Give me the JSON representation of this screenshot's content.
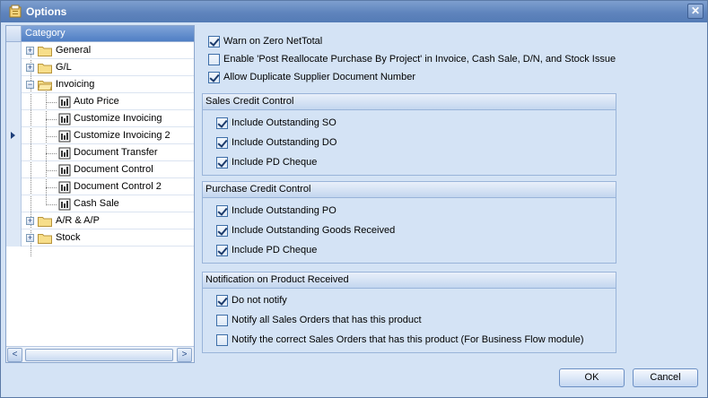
{
  "window": {
    "title": "Options",
    "close_glyph": "✕"
  },
  "tree": {
    "header": "Category",
    "nodes": [
      {
        "label": "General"
      },
      {
        "label": "G/L"
      },
      {
        "label": "Invoicing"
      },
      {
        "label": "Auto Price"
      },
      {
        "label": "Customize Invoicing"
      },
      {
        "label": "Customize Invoicing 2"
      },
      {
        "label": "Document Transfer"
      },
      {
        "label": "Document Control"
      },
      {
        "label": "Document Control 2"
      },
      {
        "label": "Cash Sale"
      },
      {
        "label": "A/R & A/P"
      },
      {
        "label": "Stock"
      }
    ],
    "selected": "Customize Invoicing 2",
    "scroll_left": "<",
    "scroll_right": ">"
  },
  "options": {
    "top": [
      {
        "label": "Warn on Zero NetTotal",
        "checked": true
      },
      {
        "label": "Enable 'Post Reallocate Purchase By Project' in Invoice, Cash Sale, D/N, and Stock Issue",
        "checked": false
      },
      {
        "label": "Allow Duplicate Supplier Document Number",
        "checked": true
      }
    ],
    "sales_credit": {
      "title": "Sales Credit Control",
      "items": [
        {
          "label": "Include Outstanding SO",
          "checked": true
        },
        {
          "label": "Include Outstanding DO",
          "checked": true
        },
        {
          "label": "Include PD Cheque",
          "checked": true
        }
      ]
    },
    "purchase_credit": {
      "title": "Purchase Credit Control",
      "items": [
        {
          "label": "Include Outstanding PO",
          "checked": true
        },
        {
          "label": "Include Outstanding Goods Received",
          "checked": true
        },
        {
          "label": "Include PD Cheque",
          "checked": true
        }
      ]
    },
    "notification": {
      "title": "Notification on Product Received",
      "items": [
        {
          "label": "Do not notify",
          "checked": true
        },
        {
          "label": "Notify all Sales Orders that has this product",
          "checked": false
        },
        {
          "label": "Notify the correct Sales Orders that has this product (For Business Flow module)",
          "checked": false
        }
      ]
    }
  },
  "buttons": {
    "ok": "OK",
    "cancel": "Cancel"
  },
  "colors": {
    "titlebar": "#5f84bd",
    "client": "#d4e3f5",
    "check": "#1b3a6b"
  }
}
